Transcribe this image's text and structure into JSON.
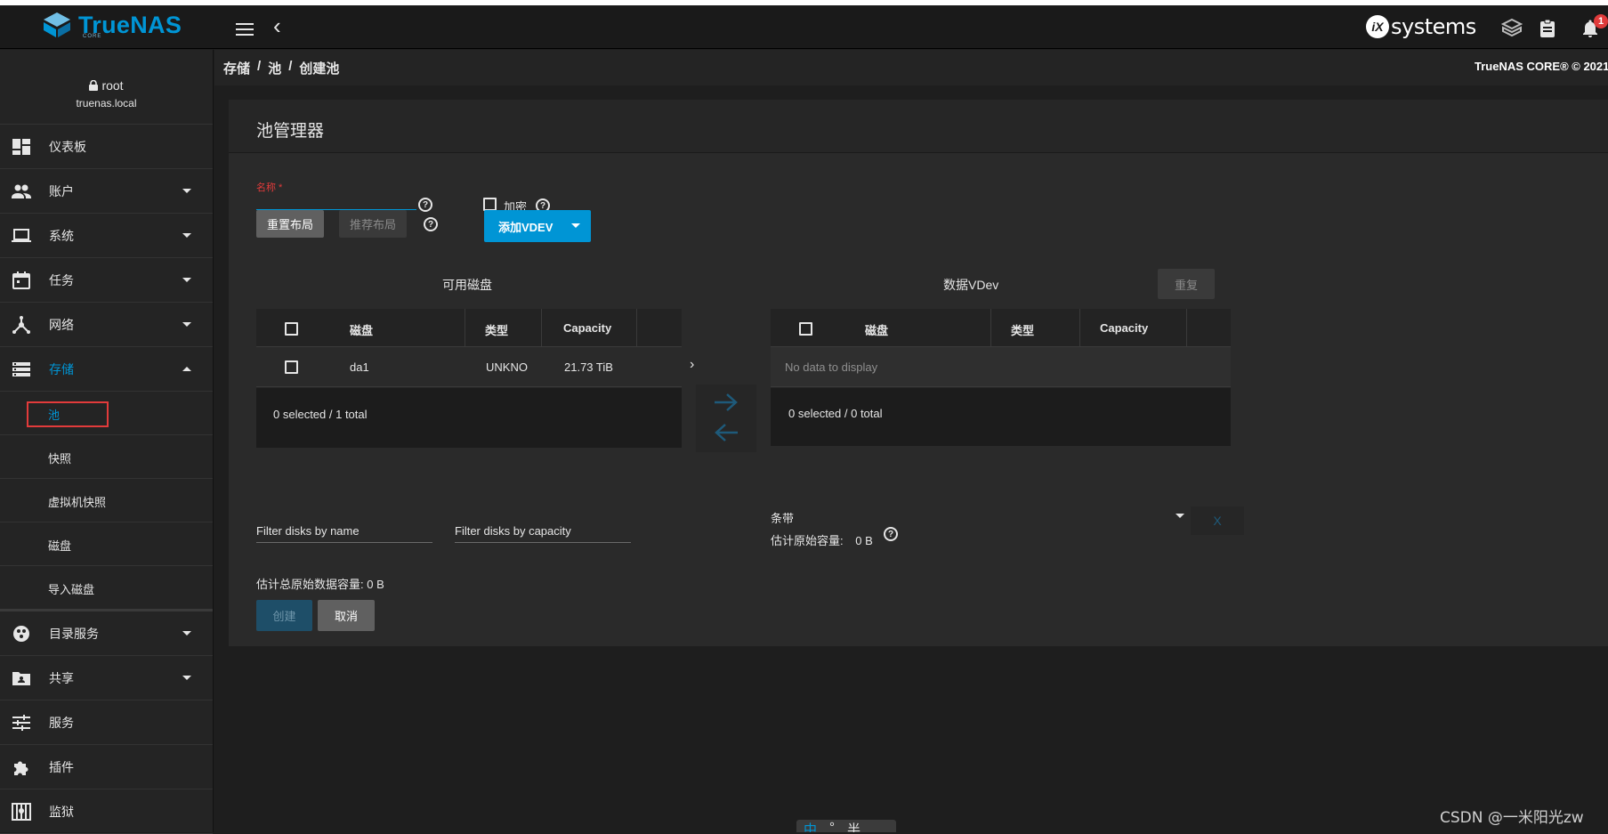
{
  "app": {
    "logo_text": "TrueNAS",
    "logo_sub": "CORE",
    "vendor_badge": "iX",
    "vendor_text": "systems",
    "notification_count": "1"
  },
  "user": {
    "name": "root",
    "host": "truenas.local"
  },
  "sidebar": {
    "items": [
      {
        "label": "仪表板",
        "icon": "dashboard-icon"
      },
      {
        "label": "账户",
        "icon": "people-icon"
      },
      {
        "label": "系统",
        "icon": "laptop-icon"
      },
      {
        "label": "任务",
        "icon": "calendar-icon"
      },
      {
        "label": "网络",
        "icon": "network-icon"
      },
      {
        "label": "存储",
        "icon": "storage-icon"
      }
    ],
    "storage_sub": [
      "池",
      "快照",
      "虚拟机快照",
      "磁盘",
      "导入磁盘"
    ],
    "items_after": [
      {
        "label": "目录服务",
        "icon": "directory-icon"
      },
      {
        "label": "共享",
        "icon": "share-folder-icon"
      },
      {
        "label": "服务",
        "icon": "tune-icon"
      },
      {
        "label": "插件",
        "icon": "puzzle-icon"
      },
      {
        "label": "监狱",
        "icon": "jail-icon"
      }
    ]
  },
  "breadcrumb": {
    "items": [
      "存储",
      "/",
      "池",
      "/",
      "创建池"
    ],
    "copyright": "TrueNAS CORE® © 2021"
  },
  "pool": {
    "title": "池管理器",
    "name_label": "名称 *",
    "name_value": "",
    "encrypt_label": "加密",
    "reset_layout": "重置布局",
    "suggest_layout": "推荐布局",
    "add_vdev": "添加VDEV",
    "available_title": "可用磁盘",
    "data_vdev_title": "数据VDev",
    "repeat": "重复",
    "available_table": {
      "headers": [
        "磁盘",
        "类型",
        "Capacity"
      ],
      "rows": [
        {
          "disk": "da1",
          "type": "UNKNO",
          "capacity": "21.73 TiB"
        }
      ],
      "footer": "0 selected / 1 total"
    },
    "vdev_table": {
      "headers": [
        "磁盘",
        "类型",
        "Capacity"
      ],
      "empty": "No data to display",
      "footer": "0 selected / 0 total"
    },
    "filter_name": "Filter disks by name",
    "filter_capacity": "Filter disks by capacity",
    "vdev_type": "条带",
    "remove_vdev": "X",
    "est_raw_label": "估计原始容量:",
    "est_raw_value": "0 B",
    "est_total": "估计总原始数据容量: 0 B",
    "create": "创建",
    "cancel": "取消"
  },
  "watermark": "CSDN @一米阳光zw",
  "ime": {
    "mode": "中",
    "punct": "°",
    "width": "半"
  },
  "colors": {
    "accent": "#0095d5",
    "alert": "#e23b3b",
    "background": "#1e1e1e"
  }
}
